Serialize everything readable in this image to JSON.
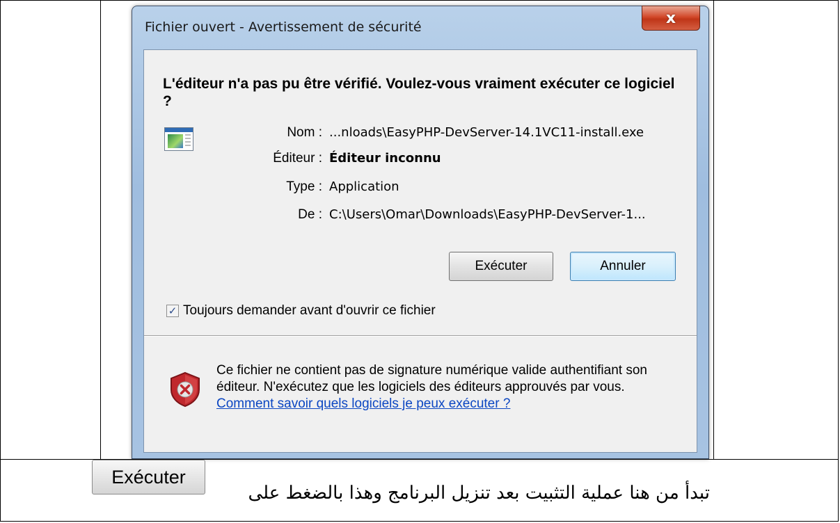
{
  "dialog": {
    "title": "Fichier ouvert - Avertissement de sécurité",
    "close_glyph": "x",
    "heading": "L'éditeur n'a pas pu être vérifié. Voulez-vous vraiment exécuter ce logiciel ?",
    "fields": [
      {
        "label": "Nom :",
        "value": "...nloads\\EasyPHP-DevServer-14.1VC11-install.exe",
        "bold": false
      },
      {
        "label": "Éditeur :",
        "value": "Éditeur inconnu",
        "bold": true
      },
      {
        "label": "Type :",
        "value": "Application",
        "bold": false
      },
      {
        "label": "De :",
        "value": "C:\\Users\\Omar\\Downloads\\EasyPHP-DevServer-1...",
        "bold": false
      }
    ],
    "run_button": "Exécuter",
    "cancel_button": "Annuler",
    "checkbox_label": "Toujours demander avant d'ouvrir ce fichier",
    "checkbox_checked": true,
    "checkbox_glyph": "✓",
    "warning_text": "Ce fichier ne contient pas de signature numérique valide authentifiant son éditeur. N'exécutez que les logiciels des éditeurs approuvés par vous. ",
    "warning_link": "Comment savoir quels logiciels je peux exécuter ?"
  },
  "caption": {
    "button_label": "Exécuter",
    "text": "تبدأ من هنا عملية التثبيت بعد تنزيل البرنامج وهذا بالضغط على"
  },
  "icons": {
    "file": "application-file-icon",
    "shield": "security-warning-shield-icon",
    "close": "close-icon"
  },
  "colors": {
    "link": "#0b46c2",
    "shield_red": "#c0282d",
    "close_red": "#c03618"
  }
}
